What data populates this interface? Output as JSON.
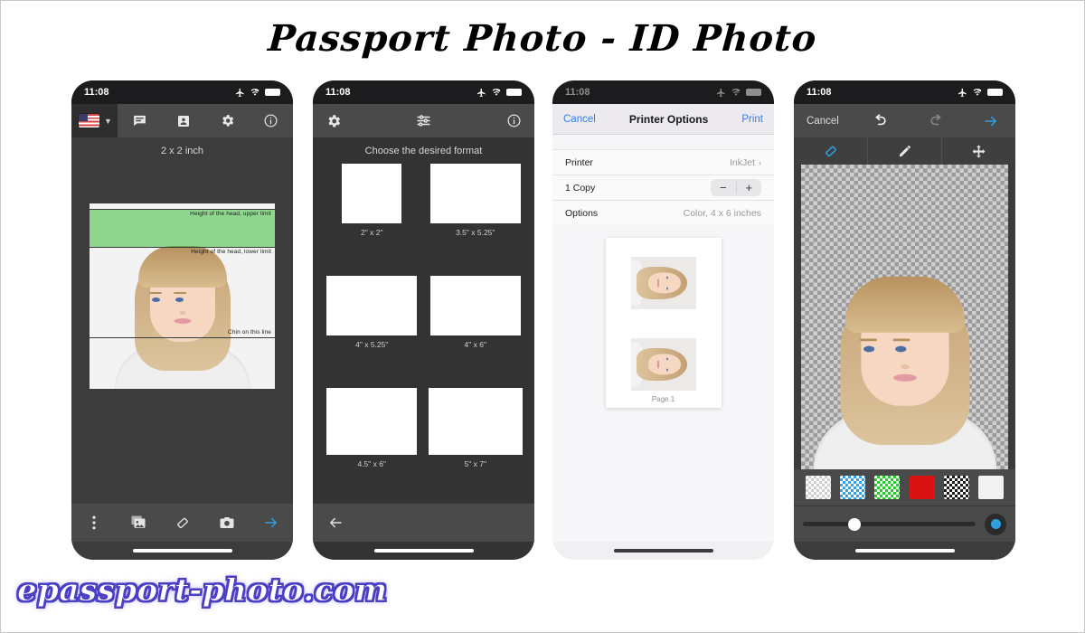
{
  "header": {
    "title": "Passport Photo - ID Photo"
  },
  "footer": {
    "brand": "epassport-photo.com"
  },
  "status": {
    "time": "11:08",
    "airplane_icon": "airplane-icon",
    "wifi_icon": "wifi-icon",
    "battery_icon": "battery-icon"
  },
  "phone1": {
    "toolbar": {
      "country_flag": "us-flag-icon",
      "dropdown_chevron": "chevron-down-icon",
      "feedback_icon": "speech-bubble-icon",
      "id_card_icon": "id-card-icon",
      "settings_icon": "gear-icon",
      "info_icon": "info-circle-icon"
    },
    "screen_title": "2 x 2 inch",
    "guides": {
      "upper_limit": "Height of the head, upper limit",
      "lower_limit": "Height of the head, lower limit",
      "chin_line": "Chin on this line"
    },
    "bottombar": {
      "more_icon": "kebab-menu-icon",
      "gallery_icon": "photo-library-icon",
      "eraser_icon": "eraser-icon",
      "camera_icon": "camera-icon",
      "next_icon": "arrow-right-icon"
    }
  },
  "phone2": {
    "toolbar": {
      "settings_icon": "gear-icon",
      "adjust_icon": "sliders-icon",
      "info_icon": "info-circle-icon"
    },
    "screen_title": "Choose the desired format",
    "formats": [
      {
        "label": "2\" x 2\"",
        "cols": 1,
        "rows": 1,
        "sheet_w": 66,
        "sheet_h": 66,
        "photo_w": 54,
        "photo_h": 54
      },
      {
        "label": "3.5\" x 5.25\"",
        "cols": 2,
        "rows": 1,
        "sheet_w": 100,
        "sheet_h": 66,
        "photo_w": 38,
        "photo_h": 48
      },
      {
        "label": "4\" x 5.25\"",
        "cols": 2,
        "rows": 1,
        "sheet_w": 100,
        "sheet_h": 66,
        "photo_w": 40,
        "photo_h": 48
      },
      {
        "label": "4\" x 6\"",
        "cols": 2,
        "rows": 1,
        "sheet_w": 100,
        "sheet_h": 66,
        "photo_w": 40,
        "photo_h": 48
      },
      {
        "label": "4.5\" x 6\"",
        "cols": 2,
        "rows": 2,
        "sheet_w": 100,
        "sheet_h": 74,
        "photo_w": 40,
        "photo_h": 32
      },
      {
        "label": "5\" x 7\"",
        "cols": 3,
        "rows": 2,
        "sheet_w": 104,
        "sheet_h": 74,
        "photo_w": 27,
        "photo_h": 32
      }
    ],
    "back_icon": "arrow-left-icon"
  },
  "phone3": {
    "nav": {
      "cancel": "Cancel",
      "title": "Printer Options",
      "print": "Print"
    },
    "rows": [
      {
        "label": "Printer",
        "value": "InkJet",
        "type": "disclosure",
        "chevron": "chevron-right-icon"
      },
      {
        "label": "1 Copy",
        "value": "",
        "type": "stepper",
        "minus": "−",
        "plus": "+"
      },
      {
        "label": "Options",
        "value": "Color, 4 x 6 inches",
        "type": "value"
      }
    ],
    "preview": {
      "page_label": "Page 1",
      "photo_count": 2
    }
  },
  "phone4": {
    "nav": {
      "cancel": "Cancel",
      "undo_icon": "undo-arrow-icon",
      "redo_icon": "redo-arrow-icon",
      "next_icon": "arrow-right-icon"
    },
    "tools": [
      {
        "name": "eraser-tool",
        "icon": "eraser-icon",
        "selected": true
      },
      {
        "name": "brush-tool",
        "icon": "pencil-icon",
        "selected": false
      },
      {
        "name": "move-tool",
        "icon": "move-arrows-icon",
        "selected": false
      }
    ],
    "swatches": [
      {
        "name": "transparent",
        "color": "#cfcfcf",
        "checker": true
      },
      {
        "name": "blue",
        "color": "#35a0e8",
        "checker": true
      },
      {
        "name": "green",
        "color": "#22cc29",
        "checker": true
      },
      {
        "name": "red",
        "color": "#d81212",
        "checker": false
      },
      {
        "name": "black",
        "color": "#1a1a1a",
        "checker": true
      },
      {
        "name": "white",
        "color": "#f2f2f2",
        "checker": false
      }
    ],
    "slider": {
      "value_percent": 30
    },
    "apply_dot_color": "#2e9fe0"
  },
  "colors": {
    "accent_blue": "#2e9fe0",
    "ios_blue": "#2c7ff0",
    "guide_green": "#8fe08f",
    "toolbar_gray": "#4a4a4a",
    "phone_dark": "#3c3c3c"
  }
}
